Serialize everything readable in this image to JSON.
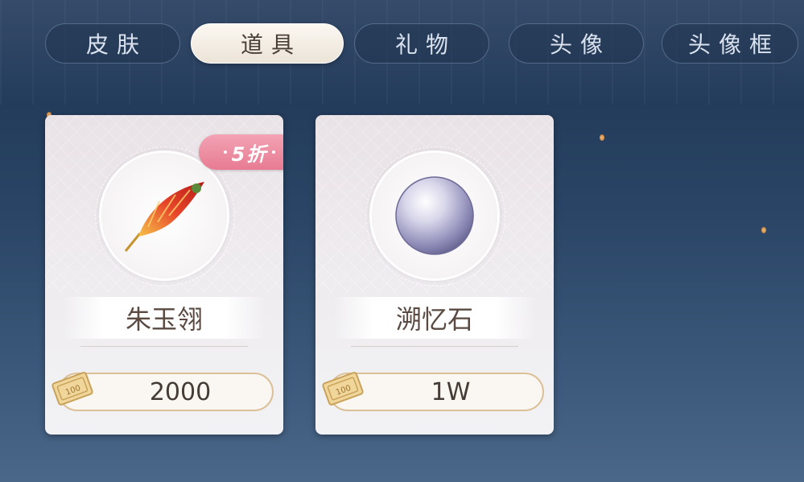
{
  "tabs": [
    {
      "label": "皮肤",
      "active": false
    },
    {
      "label": "道具",
      "active": true
    },
    {
      "label": "礼物",
      "active": false
    },
    {
      "label": "头像",
      "active": false
    },
    {
      "label": "头像框",
      "active": false
    }
  ],
  "items": [
    {
      "name": "朱玉翎",
      "price": "2000",
      "discount": "5折",
      "icon": "feather-icon"
    },
    {
      "name": "溯忆石",
      "price": "1W",
      "icon": "pearl-orb-icon"
    }
  ],
  "ticket": {
    "icon": "ticket-icon",
    "label": "100"
  },
  "colors": {
    "accent_discount": "#e77b93",
    "price_border": "#dcc098"
  }
}
